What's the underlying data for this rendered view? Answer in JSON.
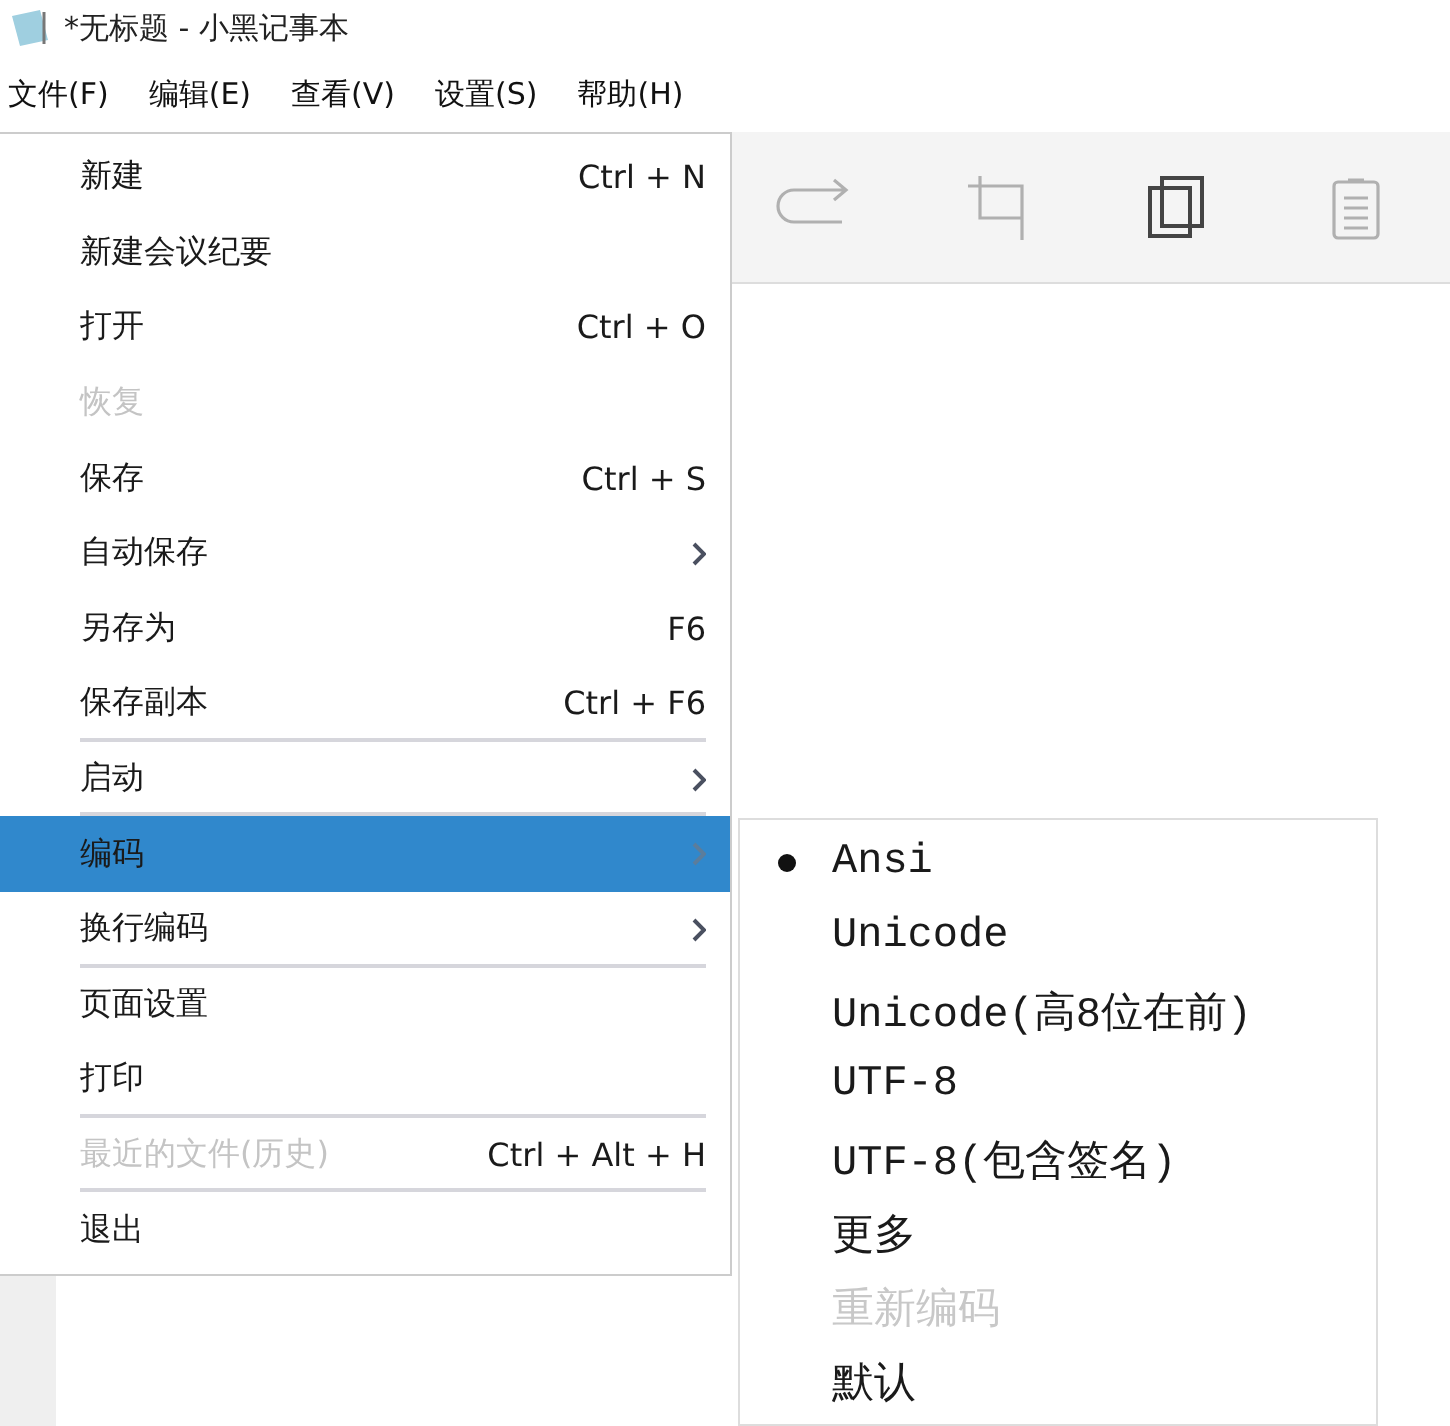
{
  "window": {
    "title": "*无标题 - 小黑记事本"
  },
  "menubar": [
    {
      "label": "文件(F)"
    },
    {
      "label": "编辑(E)"
    },
    {
      "label": "查看(V)"
    },
    {
      "label": "设置(S)"
    },
    {
      "label": "帮助(H)"
    }
  ],
  "toolbar": [
    {
      "kind": "redo",
      "disabled": true
    },
    {
      "kind": "crop",
      "disabled": true
    },
    {
      "kind": "copy",
      "disabled": false
    },
    {
      "kind": "paste",
      "disabled": true
    }
  ],
  "file_menu": [
    {
      "label": "新建",
      "shortcut": "Ctrl + N",
      "submenu": false,
      "disabled": false,
      "selected": false,
      "divider_below": false
    },
    {
      "label": "新建会议纪要",
      "submenu": false,
      "disabled": false,
      "selected": false,
      "divider_below": false
    },
    {
      "label": "打开",
      "shortcut": "Ctrl + O",
      "submenu": false,
      "disabled": false,
      "selected": false,
      "divider_below": false
    },
    {
      "label": "恢复",
      "submenu": false,
      "disabled": true,
      "selected": false,
      "divider_below": false
    },
    {
      "label": "保存",
      "shortcut": "Ctrl + S",
      "submenu": false,
      "disabled": false,
      "selected": false,
      "divider_below": false
    },
    {
      "label": "自动保存",
      "submenu": true,
      "disabled": false,
      "selected": false,
      "divider_below": false
    },
    {
      "label": "另存为",
      "shortcut": "F6",
      "submenu": false,
      "disabled": false,
      "selected": false,
      "divider_below": false
    },
    {
      "label": "保存副本",
      "shortcut": "Ctrl + F6",
      "submenu": false,
      "disabled": false,
      "selected": false,
      "divider_below": true
    },
    {
      "label": "启动",
      "submenu": true,
      "disabled": false,
      "selected": false,
      "divider_below": true
    },
    {
      "label": "编码",
      "submenu": true,
      "disabled": false,
      "selected": true,
      "divider_below": false
    },
    {
      "label": "换行编码",
      "submenu": true,
      "disabled": false,
      "selected": false,
      "divider_below": true
    },
    {
      "label": "页面设置",
      "submenu": false,
      "disabled": false,
      "selected": false,
      "divider_below": false
    },
    {
      "label": "打印",
      "submenu": false,
      "disabled": false,
      "selected": false,
      "divider_below": true
    },
    {
      "label": "最近的文件(历史)",
      "shortcut": "Ctrl + Alt + H",
      "submenu": false,
      "disabled": true,
      "selected": false,
      "divider_below": true
    },
    {
      "label": "退出",
      "submenu": false,
      "disabled": false,
      "selected": false,
      "divider_below": false
    }
  ],
  "encoding_menu": [
    {
      "label": "Ansi",
      "checked": true,
      "disabled": false
    },
    {
      "label": "Unicode",
      "checked": false,
      "disabled": false
    },
    {
      "label": "Unicode(高8位在前)",
      "checked": false,
      "disabled": false
    },
    {
      "label": "UTF-8",
      "checked": false,
      "disabled": false
    },
    {
      "label": "UTF-8(包含签名)",
      "checked": false,
      "disabled": false
    },
    {
      "label": "更多",
      "checked": false,
      "disabled": false
    },
    {
      "label": "重新编码",
      "checked": false,
      "disabled": true
    },
    {
      "label": "默认",
      "checked": false,
      "disabled": false
    }
  ]
}
